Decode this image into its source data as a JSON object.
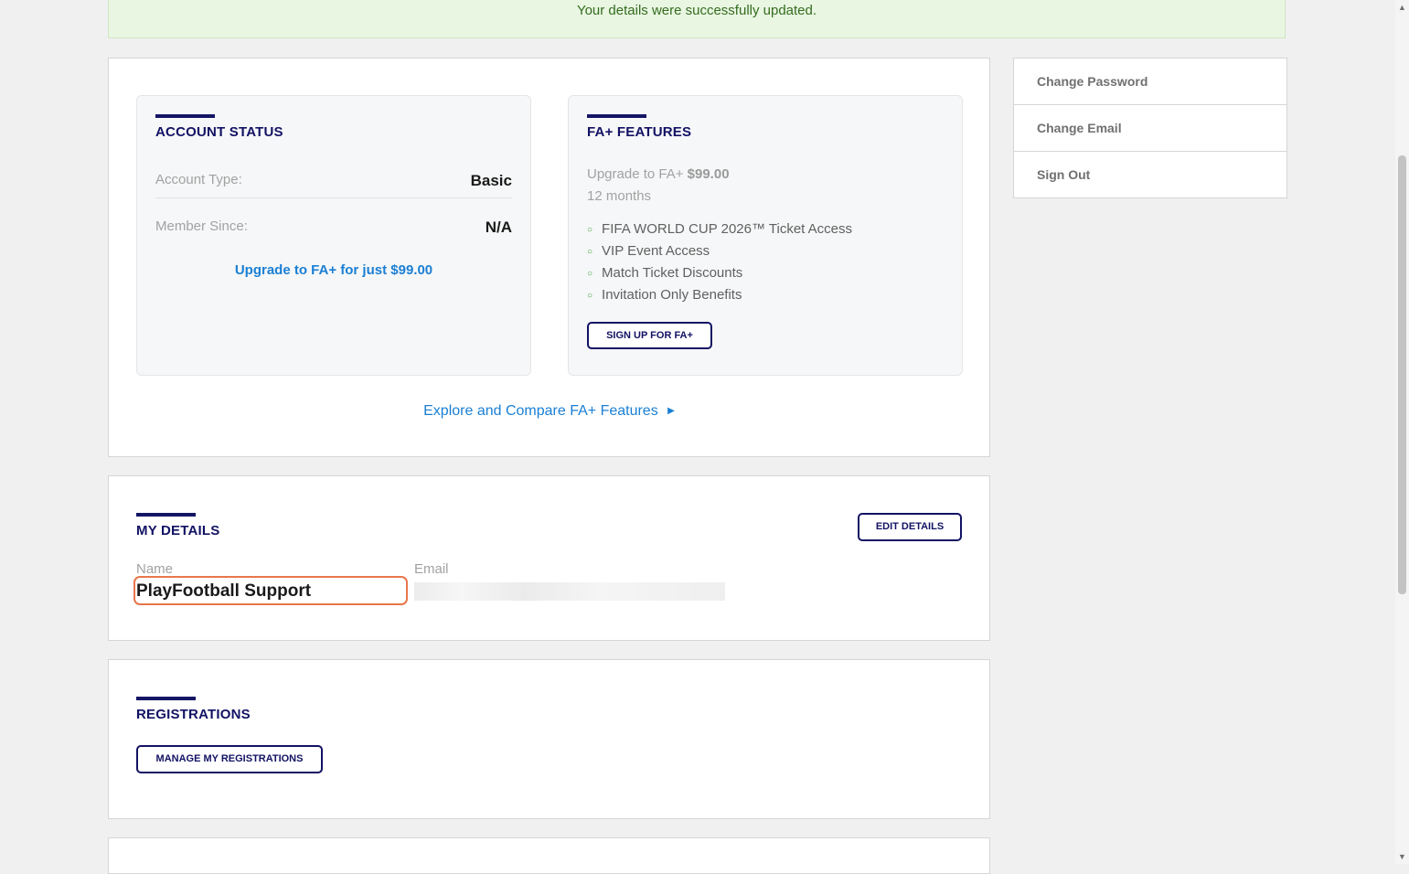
{
  "notice": {
    "message": "Your details were successfully updated."
  },
  "account_status": {
    "title": "ACCOUNT STATUS",
    "account_type_label": "Account Type:",
    "account_type_value": "Basic",
    "member_since_label": "Member Since:",
    "member_since_value": "N/A",
    "upgrade_link": "Upgrade to FA+ for just $99.00"
  },
  "fa_features": {
    "title": "FA+ FEATURES",
    "upgrade_prefix": "Upgrade to FA+",
    "price": "$99.00",
    "term": "12 months",
    "benefits": [
      "FIFA WORLD CUP 2026™ Ticket Access",
      "VIP Event Access",
      "Match Ticket Discounts",
      "Invitation Only Benefits"
    ],
    "signup_button": "SIGN UP FOR FA+"
  },
  "explore_link": "Explore and Compare FA+ Features",
  "my_details": {
    "title": "MY DETAILS",
    "edit_button": "EDIT DETAILS",
    "name_label": "Name",
    "name_value": "PlayFootball Support",
    "email_label": "Email"
  },
  "registrations": {
    "title": "REGISTRATIONS",
    "manage_button": "MANAGE MY REGISTRATIONS"
  },
  "side_menu": {
    "items": [
      "Change Password",
      "Change Email",
      "Sign Out"
    ]
  },
  "colors": {
    "navy": "#121264",
    "link_blue": "#1a7fd4",
    "success_bg": "#e9f6e2",
    "success_text": "#356c1f",
    "highlight": "#e8764a"
  }
}
